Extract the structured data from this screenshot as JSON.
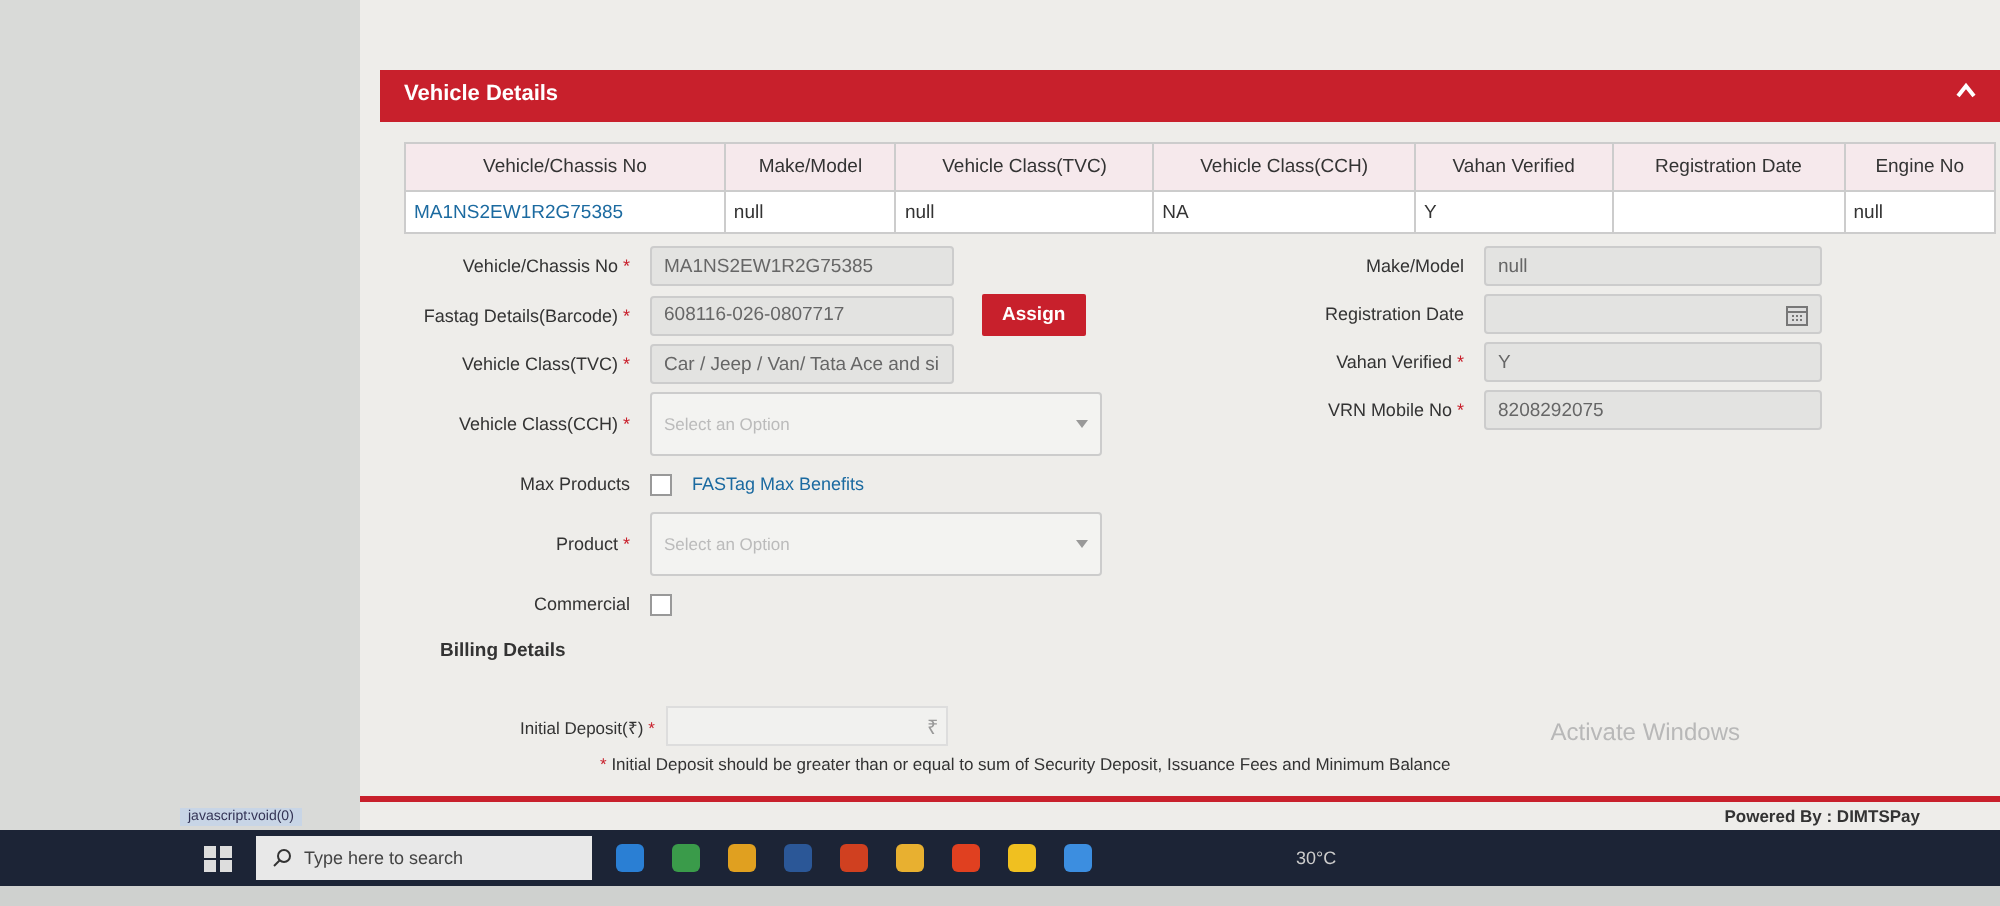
{
  "panel": {
    "title": "Vehicle Details"
  },
  "table": {
    "columns": [
      "Vehicle/Chassis No",
      "Make/Model",
      "Vehicle Class(TVC)",
      "Vehicle Class(CCH)",
      "Vahan Verified",
      "Registration Date",
      "Engine No"
    ],
    "rows": [
      [
        "MA1NS2EW1R2G75385",
        "null",
        "null",
        "NA",
        "Y",
        null,
        "null"
      ]
    ]
  },
  "left_fields": [
    {
      "kind": "text",
      "label": "Vehicle/Chassis No",
      "required_mark": "*",
      "value": "MA1NS2EW1R2G75385"
    },
    {
      "kind": "text",
      "label": "Fastag Details(Barcode)",
      "required_mark": "*",
      "value": "608116-026-0807717",
      "button": "Assign"
    },
    {
      "kind": "text",
      "label": "Vehicle Class(TVC)",
      "required_mark": "*",
      "value": "Car / Jeep / Van/ Tata Ace and si"
    },
    {
      "kind": "select",
      "label": "Vehicle Class(CCH)",
      "required_mark": "*",
      "placeholder": "Select an Option"
    },
    {
      "kind": "checkbox",
      "label": "Max Products",
      "checked": false,
      "link": "FASTag Max Benefits"
    },
    {
      "kind": "select",
      "label": "Product",
      "required_mark": "*",
      "placeholder": "Select an Option"
    },
    {
      "kind": "checkbox",
      "label": "Commercial",
      "checked": false
    }
  ],
  "right_fields": [
    {
      "kind": "text",
      "label": "Make/Model",
      "value": "null"
    },
    {
      "kind": "date",
      "label": "Registration Date"
    },
    {
      "kind": "text",
      "label": "Vahan Verified",
      "required_mark": "*",
      "value": "Y"
    },
    {
      "kind": "text",
      "label": "VRN Mobile No",
      "required_mark": "*",
      "value": "8208292075"
    }
  ],
  "billing": {
    "title": "Billing Details",
    "label": "Initial Deposit(₹)",
    "required_mark": "*",
    "currency": "₹",
    "note_mark": "*",
    "note": "Initial Deposit should be greater than or equal to sum of Security Deposit, Issuance Fees and Minimum Balance"
  },
  "footer": {
    "powered_by": "Powered By : DIMTSPay",
    "watermark": "Activate Windows",
    "status_link": "javascript:void(0)"
  },
  "taskbar": {
    "search_placeholder": "Type here to search",
    "weather": "30°C"
  }
}
